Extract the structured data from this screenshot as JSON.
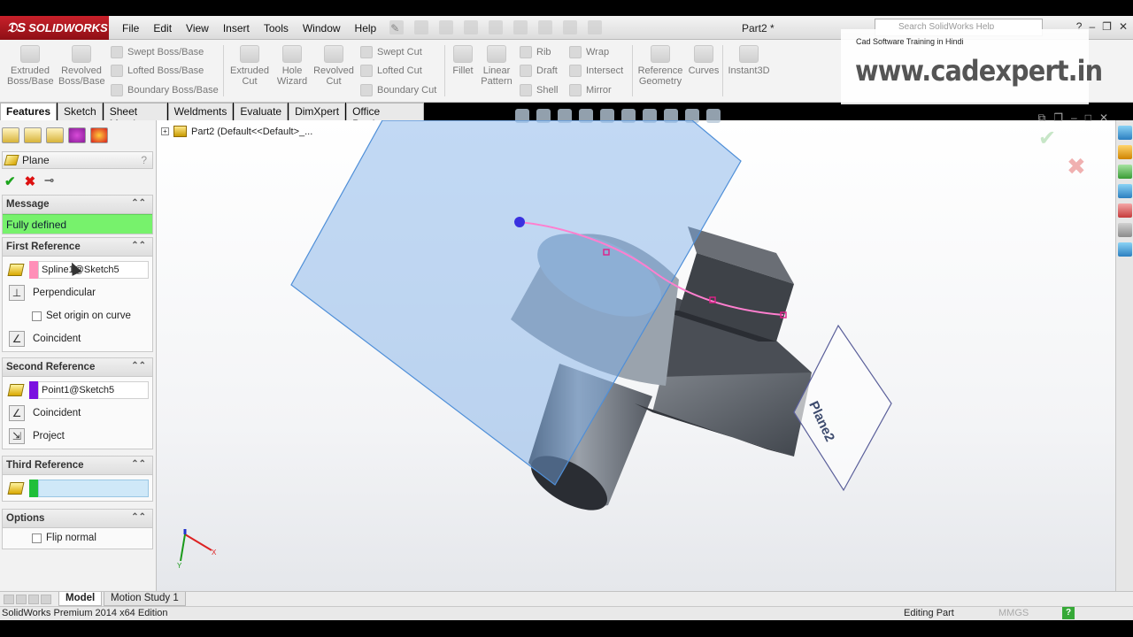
{
  "app": {
    "logo_text": "SOLIDWORKS",
    "document_title": "Part2 *",
    "search_placeholder": "Search SolidWorks Help"
  },
  "menu": [
    "File",
    "Edit",
    "View",
    "Insert",
    "Tools",
    "Window",
    "Help"
  ],
  "command_manager": {
    "extruded_boss": "Extruded\nBoss/Base",
    "revolved_boss": "Revolved\nBoss/Base",
    "swept_boss": "Swept Boss/Base",
    "lofted_boss": "Lofted Boss/Base",
    "boundary_boss": "Boundary Boss/Base",
    "extruded_cut": "Extruded\nCut",
    "hole_wizard": "Hole\nWizard",
    "revolved_cut": "Revolved\nCut",
    "swept_cut": "Swept Cut",
    "lofted_cut": "Lofted Cut",
    "boundary_cut": "Boundary Cut",
    "fillet": "Fillet",
    "linear_pattern": "Linear\nPattern",
    "rib": "Rib",
    "draft": "Draft",
    "shell": "Shell",
    "wrap": "Wrap",
    "intersect": "Intersect",
    "mirror": "Mirror",
    "reference_geometry": "Reference\nGeometry",
    "curves": "Curves",
    "instant3d": "Instant3D"
  },
  "watermark": {
    "subtitle": "Cad Software Training in Hindi",
    "url": "www.cadexpert.in"
  },
  "tabs": [
    "Features",
    "Sketch",
    "Sheet Metal",
    "Weldments",
    "Evaluate",
    "DimXpert",
    "Office Products"
  ],
  "property_manager": {
    "title": "Plane",
    "help": "?",
    "message_header": "Message",
    "message": "Fully defined",
    "first_reference": {
      "header": "First Reference",
      "selection": "Spline1@Sketch5",
      "swatch_color": "#ff8fb8",
      "constraint": "Perpendicular",
      "checkbox": "Set origin on curve",
      "option2": "Coincident"
    },
    "second_reference": {
      "header": "Second Reference",
      "selection": "Point1@Sketch5",
      "swatch_color": "#7a10e0",
      "constraint": "Coincident",
      "option2": "Project"
    },
    "third_reference": {
      "header": "Third Reference",
      "selection": "",
      "swatch_color": "#1fbf3a"
    },
    "options": {
      "header": "Options",
      "checkbox": "Flip normal"
    }
  },
  "viewport": {
    "tree_label": "Part2  (Default<<Default>_...",
    "plane_label": "Plane2",
    "axis_x": "X",
    "axis_y": "Y"
  },
  "bottom_tabs": [
    "Model",
    "Motion Study 1"
  ],
  "status": {
    "left": "SolidWorks Premium 2014 x64 Edition",
    "mode": "Editing Part",
    "units": "MMGS"
  }
}
